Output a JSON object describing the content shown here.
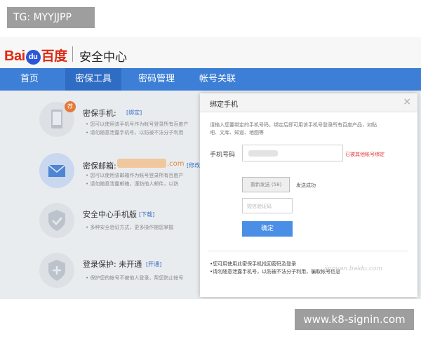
{
  "overlay": {
    "top_tag": "TG: MYYJJPP",
    "bottom_tag": "www.k8-signin.com"
  },
  "header": {
    "logo_bai": "Bai",
    "logo_du": "du",
    "logo_cn": "百度",
    "title": "安全中心"
  },
  "nav": {
    "items": [
      {
        "label": "首页"
      },
      {
        "label": "密保工具"
      },
      {
        "label": "密码管理"
      },
      {
        "label": "帐号关联"
      }
    ],
    "active_index": 1
  },
  "list": [
    {
      "title": "密保手机:",
      "link": "[绑定]",
      "badge": "荐",
      "lines": [
        "• 您可以使用该手机号作为帐号登录所有百度产",
        "• 请勿随意泄露手机号，以防被不法分子利用"
      ]
    },
    {
      "title": "密保邮箱:",
      "email_suffix": ".com",
      "link": "[修改]",
      "lines": [
        "• 您可以使用该邮箱作为帐号登录所有百度产",
        "• 请勿随意泄露邮箱，谨防他人邮件，以防"
      ]
    },
    {
      "title": "安全中心手机版",
      "link": "[下载]",
      "lines": [
        "• 多种安全验证方式，更多操作随您掌握"
      ]
    },
    {
      "title": "登录保护: 未开通",
      "link": "[开通]",
      "lines": [
        "• 保护您的帐号不被他人登录，帮您防止帐号"
      ]
    }
  ],
  "modal": {
    "title": "绑定手机",
    "close": "×",
    "intro_line1": "请输入您要绑定的手机号码，绑定后即可用该手机号登录所有百度产品，如贴",
    "intro_line2": "吧、文库、知道、地图等",
    "phone_label": "手机号码",
    "phone_warning": "已被其他帐号绑定",
    "resend_button": "重新发送 (58)",
    "send_status": "发送成功",
    "code_placeholder": "短信验证码",
    "confirm_button": "确定",
    "note1": "•您可用使用此密保手机找回密码及登录",
    "note2": "•请勿随意泄露手机号，以防被不法分子利用，骗取帐号信息"
  },
  "watermark": "jingyan.baidu.com"
}
